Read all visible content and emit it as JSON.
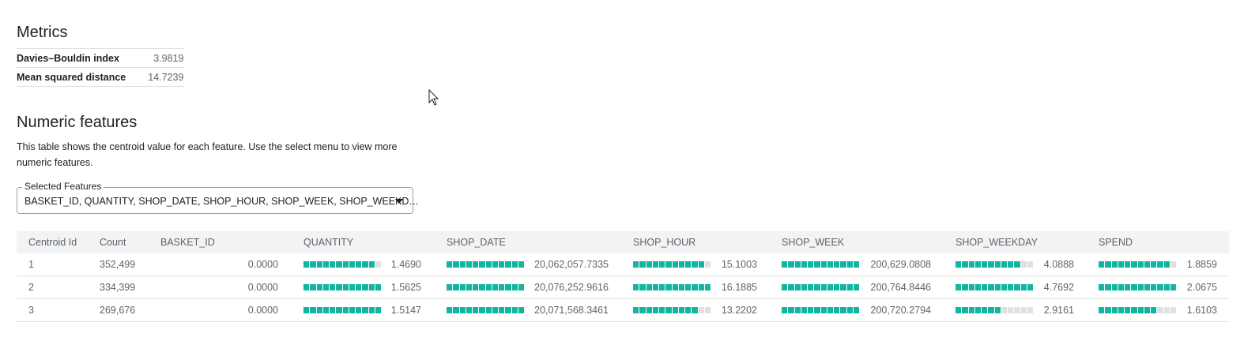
{
  "metrics": {
    "title": "Metrics",
    "rows": [
      {
        "label": "Davies–Bouldin index",
        "value": "3.9819"
      },
      {
        "label": "Mean squared distance",
        "value": "14.7239"
      }
    ]
  },
  "numeric": {
    "title": "Numeric features",
    "description": "This table shows the centroid value for each feature. Use the select menu to view more numeric features.",
    "select": {
      "label": "Selected Features",
      "value": "BASKET_ID, QUANTITY, SHOP_DATE, SHOP_HOUR, SHOP_WEEK, SHOP_WEEKD…"
    }
  },
  "table": {
    "headers": [
      "Centroid Id",
      "Count",
      "BASKET_ID",
      "QUANTITY",
      "SHOP_DATE",
      "SHOP_HOUR",
      "SHOP_WEEK",
      "SHOP_WEEKDAY",
      "SPEND"
    ],
    "rows": [
      {
        "id": "1",
        "count": "352,499",
        "basket_id": "0.0000",
        "quantity": "1.4690",
        "shop_date": "20,062,057.7335",
        "shop_hour": "15.1003",
        "shop_week": "200,629.0808",
        "shop_weekday": "4.0888",
        "spend": "1.8859",
        "fill": {
          "quantity": 0.94,
          "shop_date": 1.0,
          "shop_hour": 0.93,
          "shop_week": 1.0,
          "shop_weekday": 0.86,
          "spend": 0.91
        }
      },
      {
        "id": "2",
        "count": "334,399",
        "basket_id": "0.0000",
        "quantity": "1.5625",
        "shop_date": "20,076,252.9616",
        "shop_hour": "16.1885",
        "shop_week": "200,764.8446",
        "shop_weekday": "4.7692",
        "spend": "2.0675",
        "fill": {
          "quantity": 1.0,
          "shop_date": 1.0,
          "shop_hour": 1.0,
          "shop_week": 1.0,
          "shop_weekday": 1.0,
          "spend": 1.0
        }
      },
      {
        "id": "3",
        "count": "269,676",
        "basket_id": "0.0000",
        "quantity": "1.5147",
        "shop_date": "20,071,568.3461",
        "shop_hour": "13.2202",
        "shop_week": "200,720.2794",
        "shop_weekday": "2.9161",
        "spend": "1.6103",
        "fill": {
          "quantity": 0.97,
          "shop_date": 1.0,
          "shop_hour": 0.82,
          "shop_week": 1.0,
          "shop_weekday": 0.61,
          "spend": 0.78
        }
      }
    ]
  },
  "colors": {
    "bar_on": "#12b5a0",
    "bar_off": "#e0e0e0",
    "header_bg": "#f1f3f4"
  }
}
